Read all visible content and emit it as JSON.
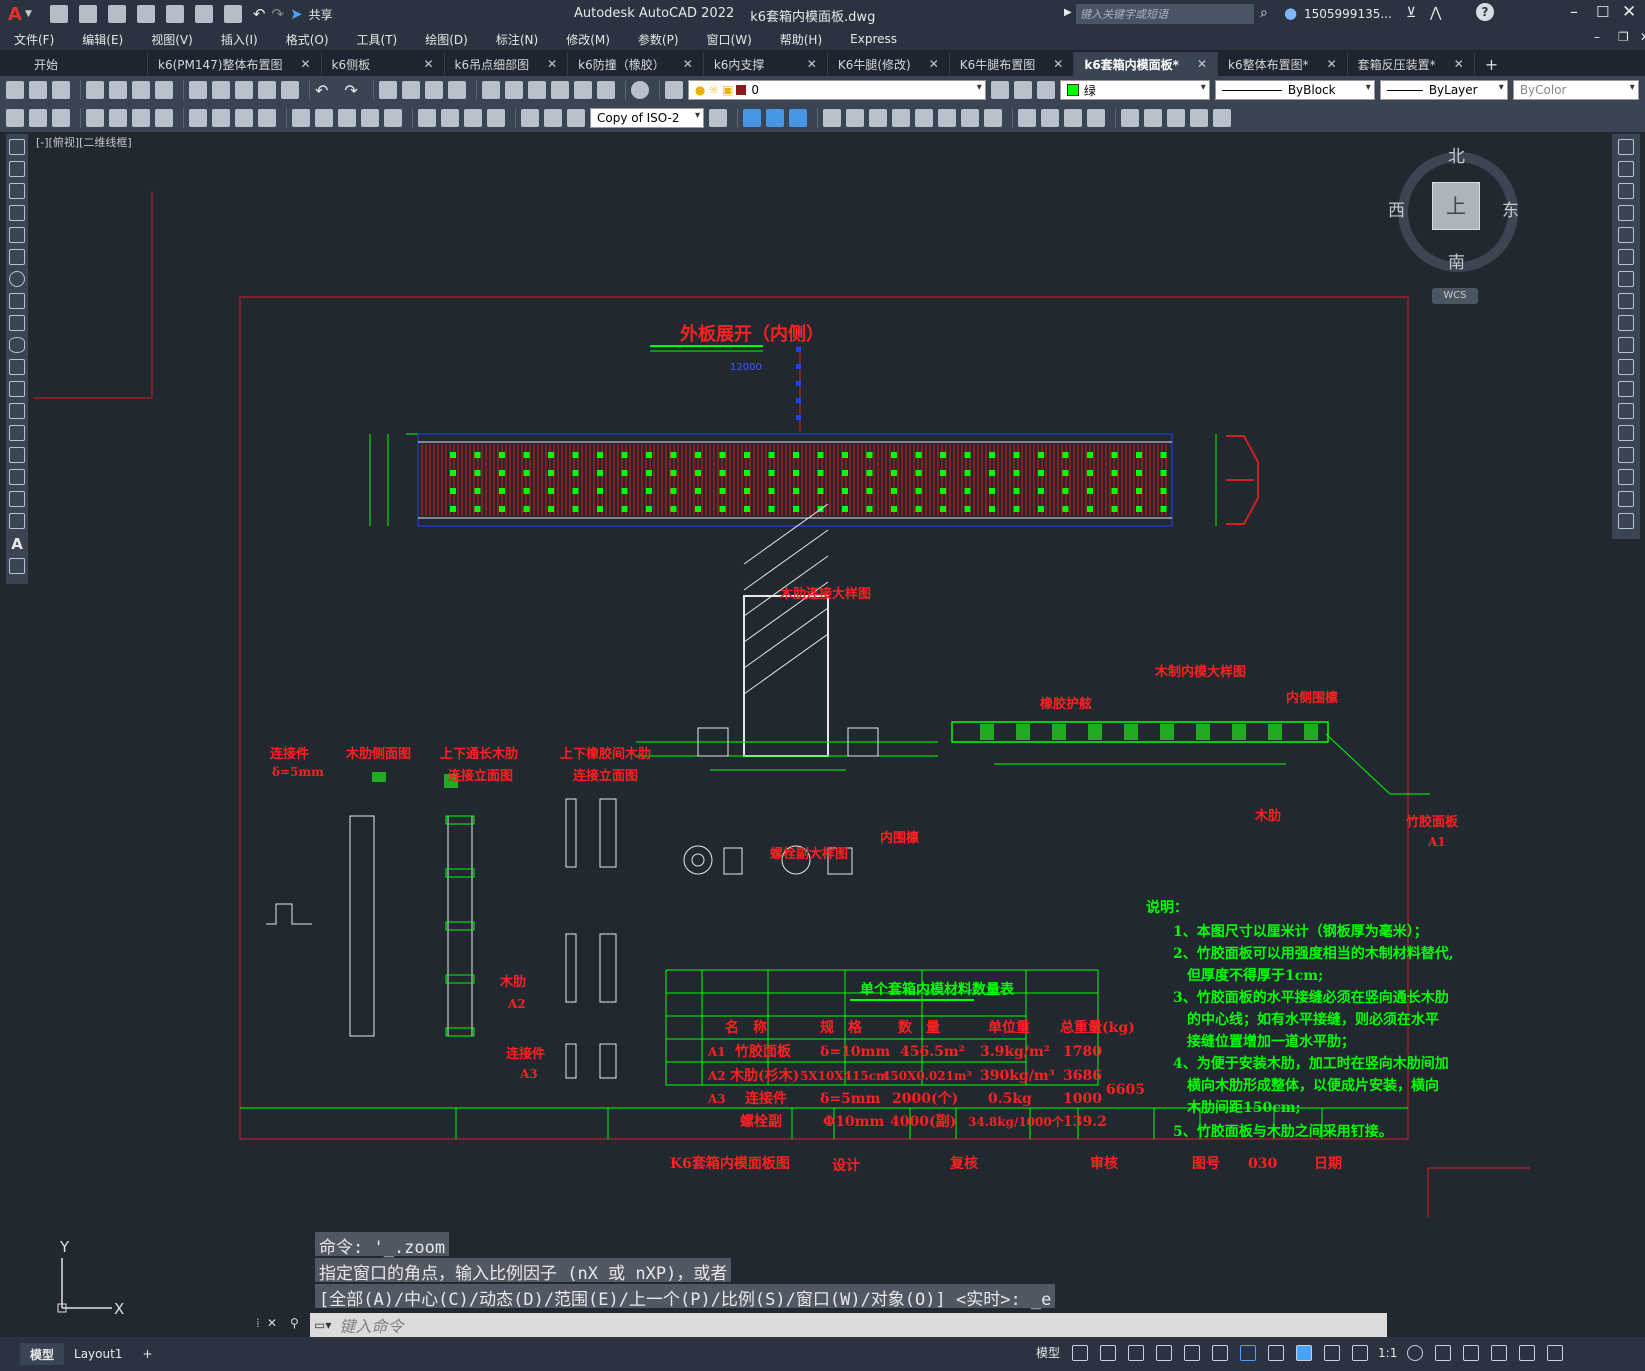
{
  "app": {
    "title": "Autodesk AutoCAD 2022",
    "file": "k6套箱内模面板.dwg",
    "share": "共享",
    "search_placeholder": "键入关键字或短语",
    "user": "1505999135..."
  },
  "menu": [
    "文件(F)",
    "编辑(E)",
    "视图(V)",
    "插入(I)",
    "格式(O)",
    "工具(T)",
    "绘图(D)",
    "标注(N)",
    "修改(M)",
    "参数(P)",
    "窗口(W)",
    "帮助(H)",
    "Express"
  ],
  "tabs": [
    {
      "label": "开始",
      "closable": false
    },
    {
      "label": "k6(PM147)整体布置图",
      "closable": true
    },
    {
      "label": "k6侧板",
      "closable": true
    },
    {
      "label": "k6吊点细部图",
      "closable": true
    },
    {
      "label": "k6防撞（橡胶）",
      "closable": true
    },
    {
      "label": "k6内支撑",
      "closable": true
    },
    {
      "label": "K6牛腿(修改)",
      "closable": true
    },
    {
      "label": "K6牛腿布置图",
      "closable": true
    },
    {
      "label": "k6套箱内模面板*",
      "closable": true,
      "active": true
    },
    {
      "label": "k6整体布置图*",
      "closable": true
    },
    {
      "label": "套箱反压装置*",
      "closable": true
    }
  ],
  "properties": {
    "layer": "0",
    "color": "绿",
    "color_hex": "#00ff00",
    "linetype": "ByBlock",
    "lineweight": "ByLayer",
    "plotstyle": "ByColor",
    "dimstyle": "Copy of ISO-2"
  },
  "viewport": {
    "label": "[-][俯视][二维线框]",
    "compass": {
      "n": "北",
      "s": "南",
      "e": "东",
      "w": "西",
      "top": "上"
    },
    "wcs": "WCS"
  },
  "drawing": {
    "title_main": "外板展开（内侧）",
    "main_dim": "12000",
    "detail_wood_joint": "木肋连接大样图",
    "detail_wood_formwork": "木制内模大样图",
    "rubber_guard": "橡胶护舷",
    "inner_hoop": "内侧围檩",
    "wood_rib": "木肋",
    "bamboo_panel": "竹胶面板",
    "bamboo_code": "A1",
    "inner_hoop2": "内围檩",
    "bolt_detail": "螺栓副大样图",
    "connector": "连接件",
    "connector_thk": "δ=5mm",
    "rib_side": "木肋侧面图",
    "upper_lower": "上下通长木肋",
    "upper_lower2": "连接立面图",
    "rubber_rib": "上下橡胶间木肋",
    "rubber_rib2": "连接立面图",
    "wood_rib_code": "木肋",
    "a2": "A2",
    "connector2": "连接件",
    "a3": "A3",
    "table_title": "单个套箱内模材料数量表",
    "table_headers": [
      "名　称",
      "规　格",
      "数　量",
      "单位重",
      "总重量(kg)"
    ],
    "table_rows": [
      {
        "code": "A1",
        "name": "竹胶面板",
        "spec": "δ=10mm",
        "qty": "456.5m²",
        "unit": "3.9kg/m²",
        "total": "1780"
      },
      {
        "code": "A2",
        "name": "木肋(杉木)",
        "spec": "5X10X415cm",
        "qty": "450X0.021m³",
        "unit": "390kg/m³",
        "total": "3686"
      },
      {
        "code": "A3",
        "name": "连接件",
        "spec": "δ=5mm",
        "qty": "2000(个)",
        "unit": "0.5kg",
        "total": "1000"
      },
      {
        "code": "",
        "name": "螺栓副",
        "spec": "Φ10mm",
        "qty": "4000(副)",
        "unit": "34.8kg/1000个",
        "total": "139.2"
      }
    ],
    "grand_total": "6605",
    "notes_title": "说明：",
    "notes": [
      "1、本图尺寸以厘米计（钢板厚为毫米）；",
      "2、竹胶面板可以用强度相当的木制材料替代,",
      "　但厚度不得厚于1cm;",
      "3、竹胶面板的水平接缝必须在竖向通长木肋",
      "　的中心线；如有水平接缝，则必须在水平",
      "　接缝位置增加一道水平肋；",
      "4、为便于安装木肋，加工时在竖向木肋间加",
      "　横向木肋形成整体，以便成片安装，横向",
      "　木肋间距150cm;",
      "5、竹胶面板与木肋之间采用钉接。"
    ],
    "titleblock": {
      "name": "K6套箱内模面板图",
      "design": "设计",
      "review": "复核",
      "approve": "审核",
      "drawing_no_label": "图号",
      "drawing_no": "030",
      "date": "日期"
    }
  },
  "command": {
    "history": [
      "命令: '_.zoom",
      "指定窗口的角点，输入比例因子 (nX 或 nXP)，或者",
      "[全部(A)/中心(C)/动态(D)/范围(E)/上一个(P)/比例(S)/窗口(W)/对象(O)] <实时>: _e"
    ],
    "placeholder": "键入命令"
  },
  "status": {
    "tabs": [
      "模型",
      "Layout1"
    ],
    "model": "模型",
    "scale": "1:1"
  }
}
